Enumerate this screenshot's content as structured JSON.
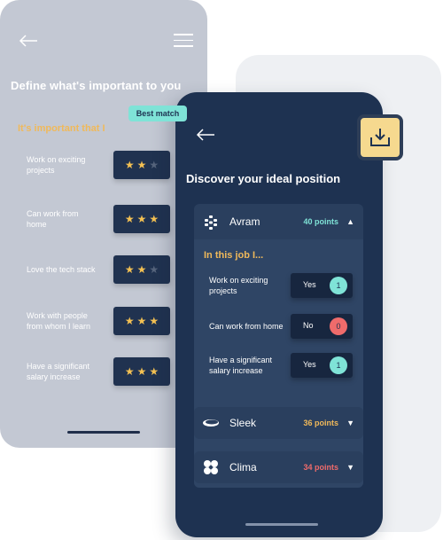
{
  "left_screen": {
    "title": "Define what's important to you",
    "subtitle": "It's important that I",
    "items": [
      {
        "label": "Work on exciting projects",
        "rating": 2
      },
      {
        "label": "Can work from home",
        "rating": 3
      },
      {
        "label": "Love the tech stack",
        "rating": 2
      },
      {
        "label": "Work with people from whom I learn",
        "rating": 3
      },
      {
        "label": "Have a significant salary increase",
        "rating": 3
      }
    ],
    "max_rating": 5
  },
  "right_screen": {
    "title": "Discover your ideal position",
    "badge": "Best match",
    "companies": [
      {
        "name": "Avram",
        "points": "40 points",
        "points_color": "#7fe3d7",
        "expanded": true
      },
      {
        "name": "Sleek",
        "points": "36 points",
        "points_color": "#f0b95a",
        "expanded": false
      },
      {
        "name": "Clima",
        "points": "34 points",
        "points_color": "#ef6b6b",
        "expanded": false
      }
    ],
    "job_subtitle": "In this job I...",
    "answers": [
      {
        "label": "Work on exciting projects",
        "answer": "Yes",
        "value": "1",
        "color": "#7fe3d7"
      },
      {
        "label": "Can work from home",
        "answer": "No",
        "value": "0",
        "color": "#ef6b6b"
      },
      {
        "label": "Have a significant salary increase",
        "answer": "Yes",
        "value": "1",
        "color": "#7fe3d7"
      }
    ]
  },
  "icons": {
    "back": "arrow-left-icon",
    "menu": "hamburger-icon",
    "download": "download-icon",
    "expand": "caret-down-icon",
    "collapse": "caret-up-icon"
  },
  "colors": {
    "left_bg": "#c3c8d3",
    "right_bg": "#1e3251",
    "accent_yellow": "#f0b95a",
    "accent_teal": "#7fe3d7",
    "accent_red": "#ef6b6b"
  }
}
